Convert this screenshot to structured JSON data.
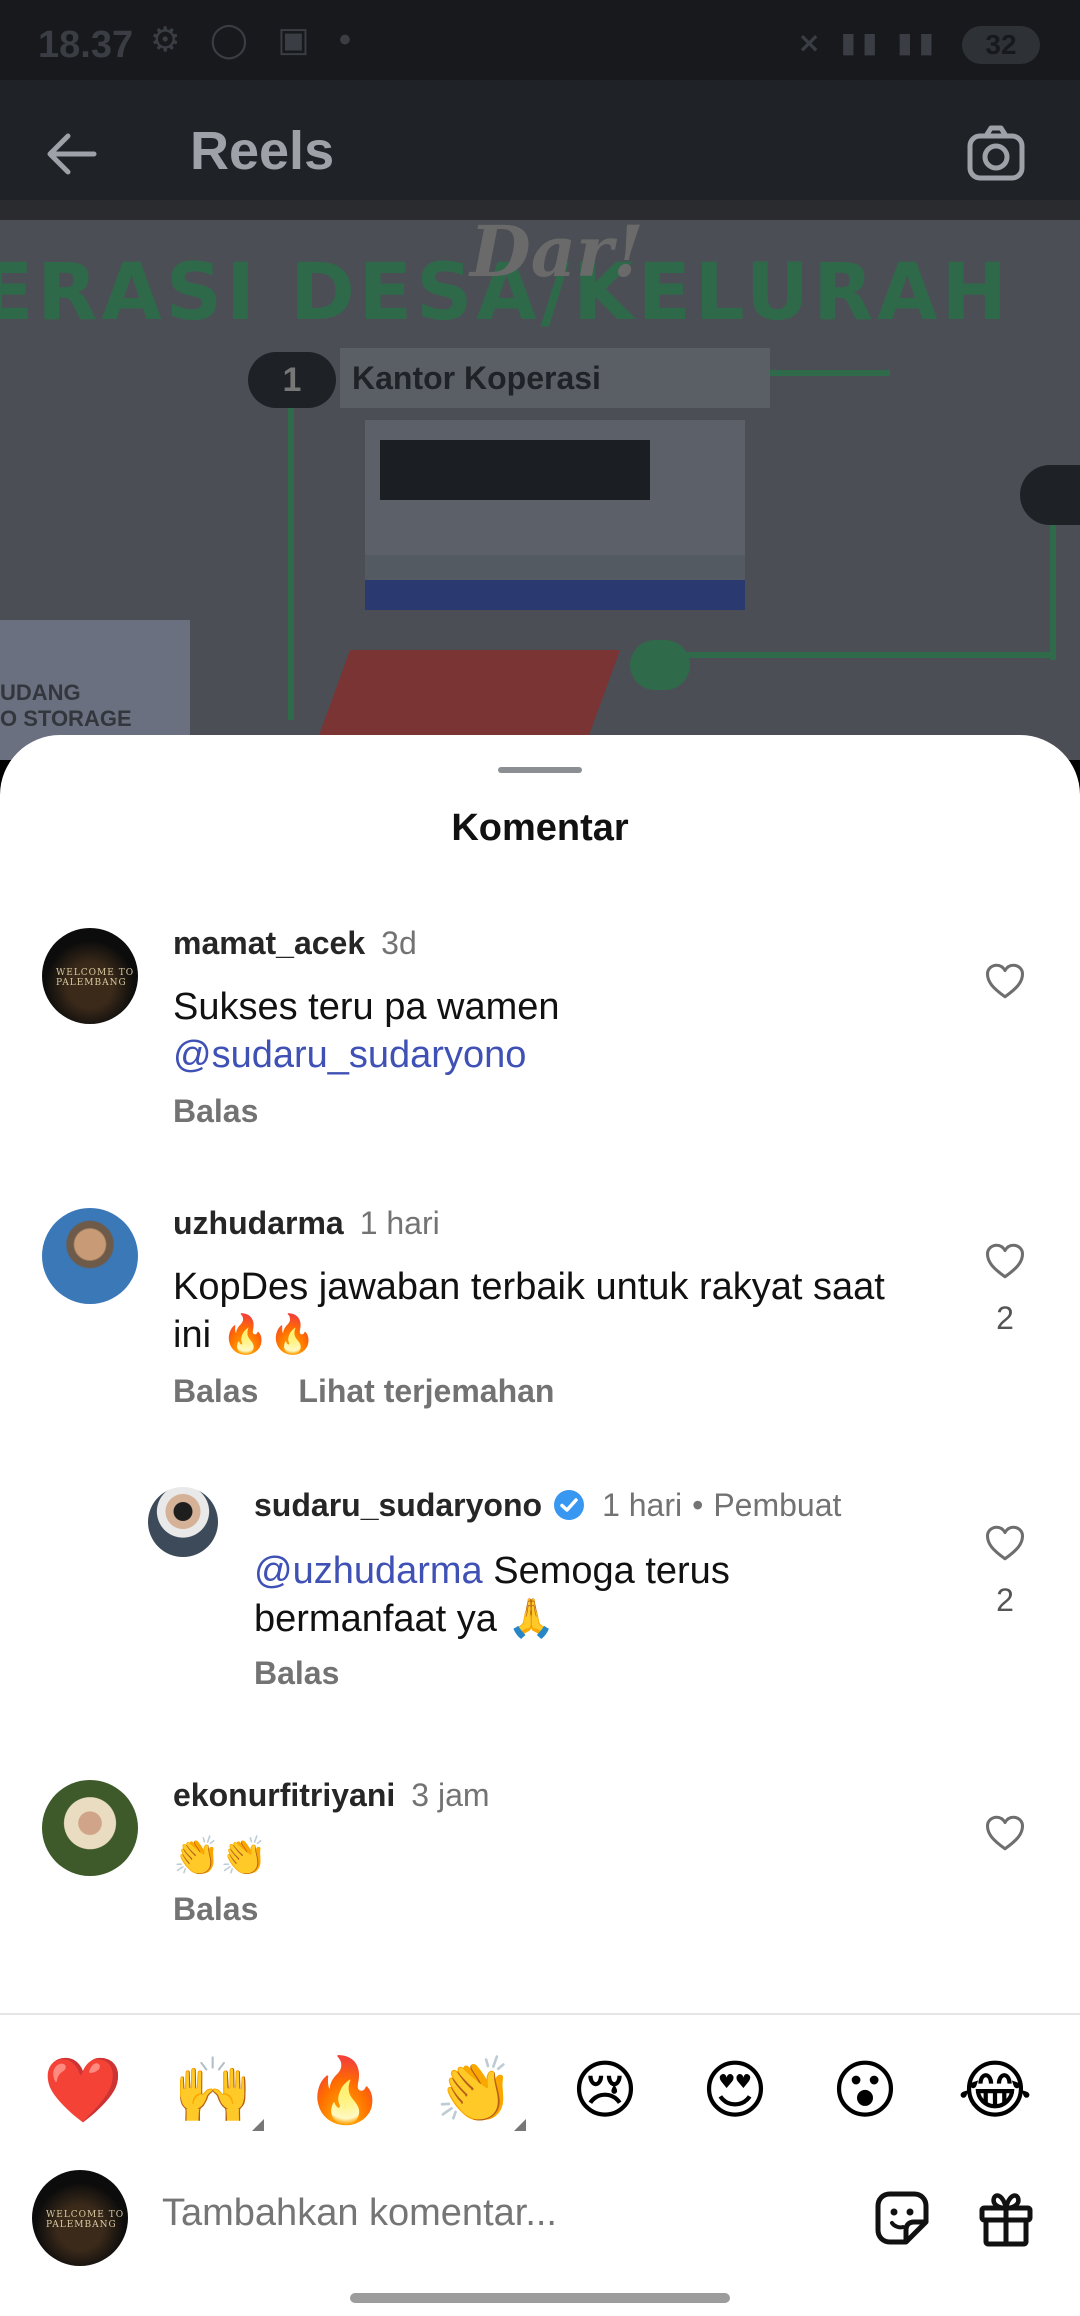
{
  "status_bar": {
    "time": "18.37",
    "battery": "32"
  },
  "header": {
    "title": "Reels"
  },
  "reel_bg": {
    "banner": "ERASI DESA/KELURAH",
    "brand": "Dar!",
    "step1": "1",
    "kantor": "Kantor Koperasi",
    "gudang": "UDANG\nO STORAGE"
  },
  "sheet": {
    "title": "Komentar"
  },
  "comments": [
    {
      "username": "mamat_acek",
      "time": "3d",
      "text": "Sukses teru pa wamen",
      "mention": "@sudaru_sudaryono",
      "reply_label": "Balas"
    },
    {
      "username": "uzhudarma",
      "time": "1 hari",
      "text": "KopDes jawaban terbaik untuk rakyat saat ini 🔥🔥",
      "reply_label": "Balas",
      "translate_label": "Lihat terjemahan",
      "likes": "2"
    },
    {
      "username": "sudaru_sudaryono",
      "time": "1 hari",
      "creator_label": "Pembuat",
      "mention": "@uzhudarma",
      "text": " Semoga terus bermanfaat ya 🙏",
      "reply_label": "Balas",
      "likes": "2"
    },
    {
      "username": "ekonurfitriyani",
      "time": "3 jam",
      "text": "👏👏",
      "reply_label": "Balas"
    }
  ],
  "emoji_bar": [
    "❤️",
    "🙌",
    "🔥",
    "👏",
    "😢",
    "😍",
    "😮",
    "😂"
  ],
  "composer": {
    "placeholder": "Tambahkan komentar..."
  },
  "colors": {
    "mention": "#3f51b5",
    "verified": "#3897f0",
    "sheet_bg": "#ffffff"
  }
}
